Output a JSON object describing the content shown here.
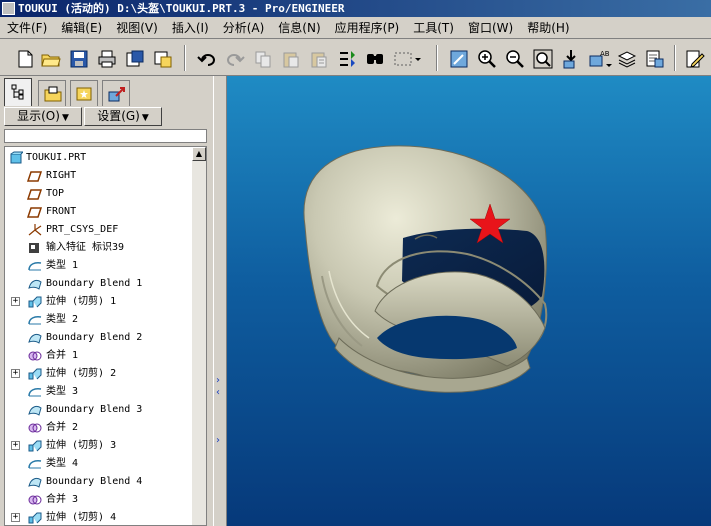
{
  "window": {
    "title": "TOUKUI (活动的) D:\\头盔\\TOUKUI.PRT.3 - Pro/ENGINEER"
  },
  "menu": [
    "文件(F)",
    "编辑(E)",
    "视图(V)",
    "插入(I)",
    "分析(A)",
    "信息(N)",
    "应用程序(P)",
    "工具(T)",
    "窗口(W)",
    "帮助(H)"
  ],
  "toolbar": {
    "icons": [
      "new-file-icon",
      "open-folder-icon",
      "save-icon",
      "print-icon",
      "save-copy-icon",
      "erase-icon",
      "undo-icon",
      "redo-icon",
      "copy-icon",
      "paste-icon",
      "paste-special-icon",
      "regenerate-icon",
      "find-icon",
      "select-box-icon",
      "repaint-icon",
      "zoom-in-icon",
      "zoom-out-icon",
      "refit-icon",
      "orient-icon",
      "named-views-icon",
      "layers-icon",
      "view-manager-icon",
      "edit-icon"
    ]
  },
  "panel": {
    "show_button": "显示(O)",
    "settings_button": "设置(G)"
  },
  "model_tree": [
    {
      "label": "TOUKUI.PRT",
      "icon": "part-icon",
      "level": 0,
      "expandable": false
    },
    {
      "label": "RIGHT",
      "icon": "datum-plane-icon",
      "level": 1,
      "expandable": false
    },
    {
      "label": "TOP",
      "icon": "datum-plane-icon",
      "level": 1,
      "expandable": false
    },
    {
      "label": "FRONT",
      "icon": "datum-plane-icon",
      "level": 1,
      "expandable": false
    },
    {
      "label": "PRT_CSYS_DEF",
      "icon": "csys-icon",
      "level": 1,
      "expandable": false
    },
    {
      "label": "输入特征 标识39",
      "icon": "import-feature-icon",
      "level": 1,
      "expandable": false
    },
    {
      "label": "类型 1",
      "icon": "style-icon",
      "level": 1,
      "expandable": false
    },
    {
      "label": "Boundary Blend 1",
      "icon": "boundary-blend-icon",
      "level": 1,
      "expandable": false
    },
    {
      "label": "拉伸 (切剪) 1",
      "icon": "extrude-cut-icon",
      "level": 1,
      "expandable": true
    },
    {
      "label": "类型 2",
      "icon": "style-icon",
      "level": 1,
      "expandable": false
    },
    {
      "label": "Boundary Blend 2",
      "icon": "boundary-blend-icon",
      "level": 1,
      "expandable": false
    },
    {
      "label": "合并 1",
      "icon": "merge-icon",
      "level": 1,
      "expandable": false
    },
    {
      "label": "拉伸 (切剪) 2",
      "icon": "extrude-cut-icon",
      "level": 1,
      "expandable": true
    },
    {
      "label": "类型 3",
      "icon": "style-icon",
      "level": 1,
      "expandable": false
    },
    {
      "label": "Boundary Blend 3",
      "icon": "boundary-blend-icon",
      "level": 1,
      "expandable": false
    },
    {
      "label": "合并 2",
      "icon": "merge-icon",
      "level": 1,
      "expandable": false
    },
    {
      "label": "拉伸 (切剪) 3",
      "icon": "extrude-cut-icon",
      "level": 1,
      "expandable": true
    },
    {
      "label": "类型 4",
      "icon": "style-icon",
      "level": 1,
      "expandable": false
    },
    {
      "label": "Boundary Blend 4",
      "icon": "boundary-blend-icon",
      "level": 1,
      "expandable": false
    },
    {
      "label": "合并 3",
      "icon": "merge-icon",
      "level": 1,
      "expandable": false
    },
    {
      "label": "拉伸 (切剪) 4",
      "icon": "extrude-cut-icon",
      "level": 1,
      "expandable": true
    }
  ],
  "colors": {
    "viewport_top": "#1f8bc4",
    "viewport_bottom": "#06397a",
    "helmet_shell": "#c9c8b2",
    "star": "#e8141a"
  }
}
